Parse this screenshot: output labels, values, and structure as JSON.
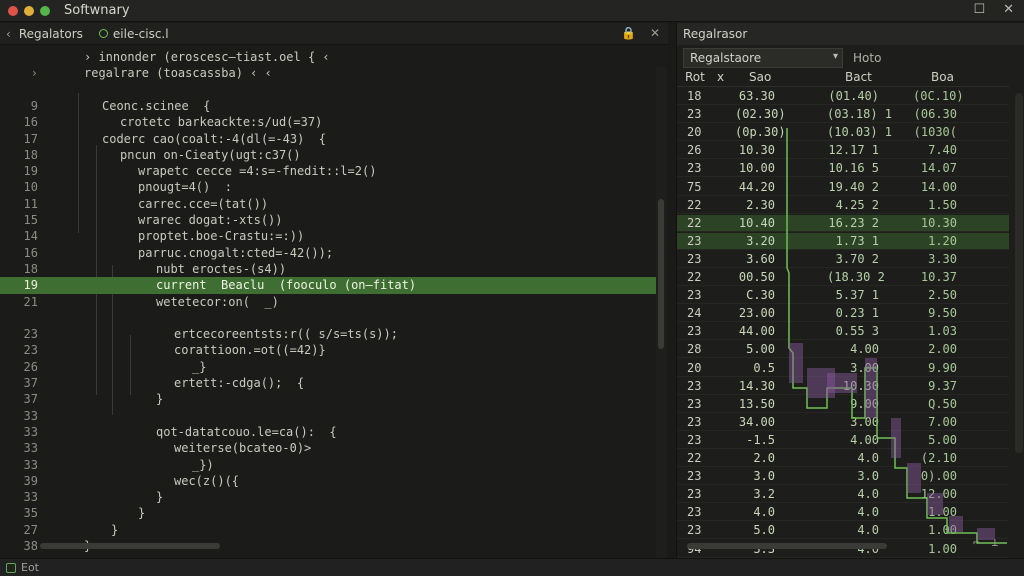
{
  "window": {
    "title": "Softwnary",
    "controls": [
      "☐",
      "✕"
    ]
  },
  "editor": {
    "tabs": [
      {
        "label": "Regalators"
      },
      {
        "label": "eile-cisc.l"
      }
    ],
    "tab_actions": [
      "🔒",
      "✕"
    ],
    "lines": [
      {
        "ln": "",
        "code": "› innonder (eroscesc—tiast.oel { ‹",
        "indent": 4
      },
      {
        "ln": "›",
        "code": "regalrare (toascassba) ‹ ‹",
        "indent": 4
      },
      {
        "ln": "",
        "code": "",
        "indent": 0
      },
      {
        "ln": "9",
        "code": "Ceonc.scinee  {",
        "indent": 6
      },
      {
        "ln": "16",
        "code": "crotetc barkeackte:s/ud(=37)",
        "indent": 8
      },
      {
        "ln": "17",
        "code": "coderc cao(coalt:-4(dl(=-43)  {",
        "indent": 6
      },
      {
        "ln": "18",
        "code": "pncun on-Cieaty(ugt:c37()",
        "indent": 8
      },
      {
        "ln": "19",
        "code": "wrapetc cecce =4:s=-fnedit::l=2()",
        "indent": 10
      },
      {
        "ln": "10",
        "code": "pnougt=4()  :",
        "indent": 10
      },
      {
        "ln": "11",
        "code": "carrec.cce=(tat())",
        "indent": 10
      },
      {
        "ln": "15",
        "code": "wrarec dogat:-xts())",
        "indent": 10
      },
      {
        "ln": "14",
        "code": "proptet.boe-Crastu:=:))",
        "indent": 10
      },
      {
        "ln": "16",
        "code": "parruc.cnogalt:cted=-42());",
        "indent": 10
      },
      {
        "ln": "18",
        "code": "nubt eroctes-(s4))",
        "indent": 12
      },
      {
        "ln": "19",
        "code": "current  Beaclu  (fooculo (on—fitat)",
        "indent": 12,
        "active": true
      },
      {
        "ln": "21",
        "code": "wetetecor:on(  _)",
        "indent": 12
      },
      {
        "ln": "",
        "code": "",
        "indent": 0
      },
      {
        "ln": "23",
        "code": "ertcecoreentsts:r(( s/s=ts(s));",
        "indent": 14
      },
      {
        "ln": "23",
        "code": "corattioon.=ot((=42)}",
        "indent": 14
      },
      {
        "ln": "26",
        "code": "_}",
        "indent": 16
      },
      {
        "ln": "37",
        "code": "ertett:-cdga();  {",
        "indent": 14
      },
      {
        "ln": "37",
        "code": "}",
        "indent": 12
      },
      {
        "ln": "33",
        "code": "",
        "indent": 0
      },
      {
        "ln": "33",
        "code": "qot-datatcouo.le=ca():  {",
        "indent": 12
      },
      {
        "ln": "33",
        "code": "weiterse(bcateo-0)>",
        "indent": 14
      },
      {
        "ln": "33",
        "code": "_})",
        "indent": 16
      },
      {
        "ln": "39",
        "code": "wec(z()({",
        "indent": 14
      },
      {
        "ln": "33",
        "code": "}",
        "indent": 12
      },
      {
        "ln": "35",
        "code": "}",
        "indent": 10
      },
      {
        "ln": "27",
        "code": "}",
        "indent": 7
      },
      {
        "ln": "38",
        "code": "}",
        "indent": 4
      }
    ]
  },
  "panel": {
    "title": "Regalrasor",
    "select_value": "Regalstaore",
    "helo": "Hoto",
    "columns": [
      "Rot",
      "x",
      "Sao",
      "Bact",
      "Boa"
    ],
    "rows": [
      [
        "18",
        "63.30",
        "(01.40)",
        "(0C.10)"
      ],
      [
        "23",
        "(02.30)",
        "(03.18)  1",
        "(06.30"
      ],
      [
        "20",
        "(0p.30)",
        "(10.03)  1",
        "(1030("
      ],
      [
        "26",
        "10.30",
        "12.17  1",
        "7.40"
      ],
      [
        "23",
        "10.00",
        "10.16  5",
        "14.07"
      ],
      [
        "75",
        "44.20",
        "19.40  2",
        "14.00"
      ],
      [
        "22",
        "2.30",
        "4.25  2",
        "1.50"
      ],
      [
        "22",
        "10.40",
        "16.23  2",
        "10.30"
      ],
      [
        "23",
        "3.20",
        "1.73  1",
        "1.20"
      ],
      [
        "23",
        "3.60",
        "3.70  2",
        "3.30"
      ],
      [
        "22",
        "00.50",
        "(18.30  2",
        "10.37"
      ],
      [
        "23",
        "C.30",
        "5.37  1",
        "2.50"
      ],
      [
        "24",
        "23.00",
        "0.23  1",
        "9.50"
      ],
      [
        "23",
        "44.00",
        "0.55  3",
        "1.03"
      ],
      [
        "28",
        "5.00",
        "4.00",
        "2.00"
      ],
      [
        "20",
        "0.5",
        "3.00",
        "9.90"
      ],
      [
        "23",
        "14.30",
        "10.30",
        "9.37"
      ],
      [
        "23",
        "13.50",
        "9.00",
        "Q.50"
      ],
      [
        "23",
        "34.00",
        "3.00",
        "7.00"
      ],
      [
        "23",
        "-1.5",
        "4.00",
        "5.00"
      ],
      [
        "22",
        "2.0",
        "4.0",
        "(2.10"
      ],
      [
        "23",
        "3.0",
        "3.0",
        "0).00"
      ],
      [
        "23",
        "3.2",
        "4.0",
        "12.00"
      ],
      [
        "23",
        "4.0",
        "4.0",
        "1.00"
      ],
      [
        "23",
        "5.0",
        "4.0",
        "1.00"
      ],
      [
        "94",
        "3.3",
        "4.0",
        "1.00"
      ]
    ],
    "selected_rows": [
      7,
      8
    ]
  },
  "statusbar": {
    "text": "Eot"
  },
  "colors": {
    "accent": "#3f6e32",
    "green": "#6fbf56"
  }
}
